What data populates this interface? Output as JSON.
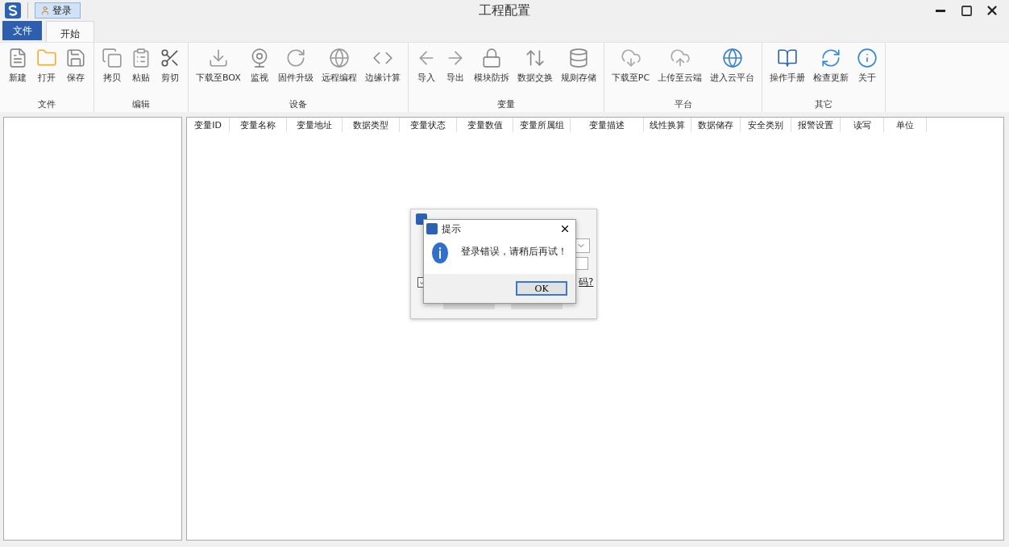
{
  "window": {
    "title": "工程配置"
  },
  "quick_access": {
    "label": "登录"
  },
  "tabs": [
    {
      "label": "文件",
      "kind": "file",
      "selected": false
    },
    {
      "label": "开始",
      "kind": "tab",
      "selected": true
    }
  ],
  "ribbon": [
    {
      "label": "文件",
      "buttons": [
        "新建",
        "打开",
        "保存"
      ]
    },
    {
      "label": "编辑",
      "buttons": [
        "拷贝",
        "粘贴",
        "剪切"
      ]
    },
    {
      "label": "设备",
      "buttons": [
        "下载至BOX",
        "监视",
        "固件升级",
        "远程编程",
        "边缘计算"
      ]
    },
    {
      "label": "变量",
      "buttons": [
        "导入",
        "导出",
        "模块防拆",
        "数据交换",
        "规则存储"
      ]
    },
    {
      "label": "平台",
      "buttons": [
        "下载至PC",
        "上传至云端",
        "进入云平台"
      ]
    },
    {
      "label": "其它",
      "buttons": [
        "操作手册",
        "检查更新",
        "关于"
      ]
    }
  ],
  "table": {
    "columns": [
      "变量ID",
      "变量名称",
      "变量地址",
      "数据类型",
      "变量状态",
      "变量数值",
      "变量所属组",
      "变量描述",
      "线性换算",
      "数据储存",
      "安全类别",
      "报警设置",
      "读写",
      "单位"
    ]
  },
  "login_dialog": {
    "remember": {
      "checked": true
    },
    "link": "码?"
  },
  "message_box": {
    "title": "提示",
    "message": "登录错误，请稍后再试！",
    "button": "OK"
  }
}
